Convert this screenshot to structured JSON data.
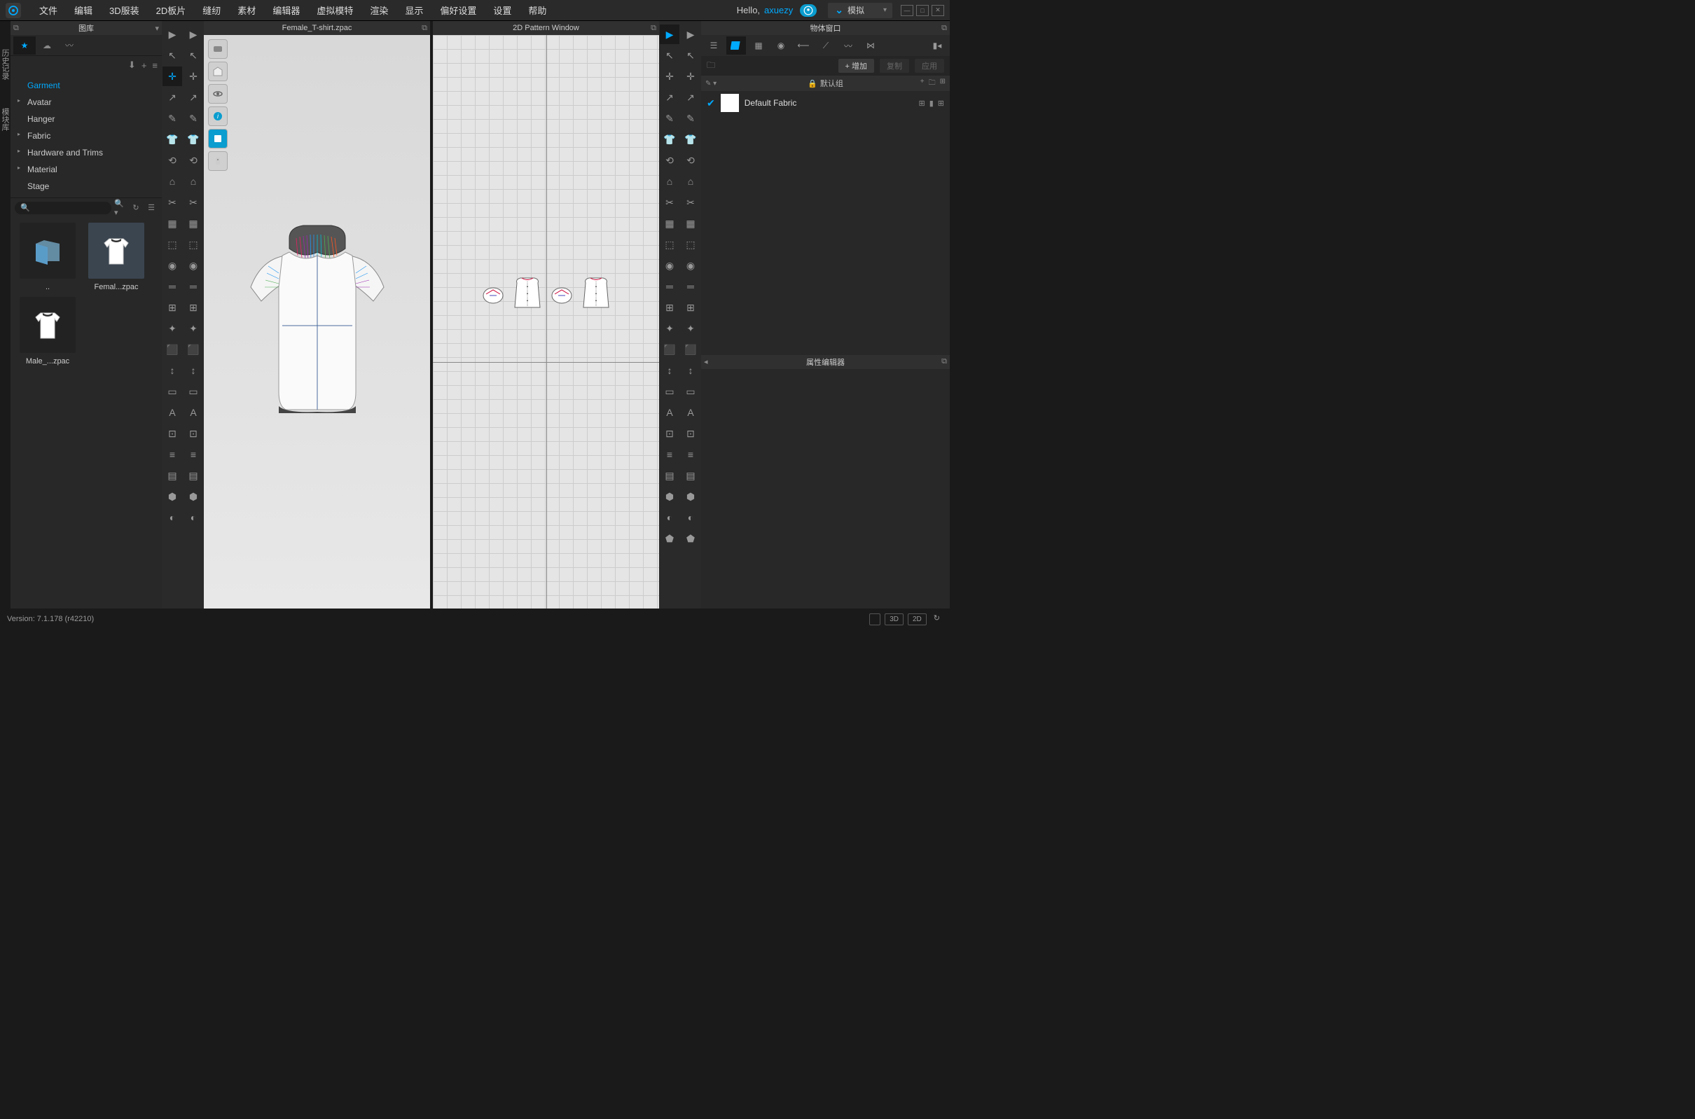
{
  "menubar": {
    "items": [
      "文件",
      "编辑",
      "3D服装",
      "2D板片",
      "缝纫",
      "素材",
      "编辑器",
      "虚拟模特",
      "渲染",
      "显示",
      "偏好设置",
      "设置",
      "帮助"
    ],
    "hello": "Hello,",
    "user": "axuezy",
    "simulate": "模拟"
  },
  "side_tabs": [
    "历史记录",
    "模块库"
  ],
  "library": {
    "title": "图库",
    "tree": [
      {
        "label": "Garment",
        "sel": true,
        "exp": ""
      },
      {
        "label": "Avatar",
        "exp": "▸"
      },
      {
        "label": "Hanger",
        "exp": ""
      },
      {
        "label": "Fabric",
        "exp": "▸"
      },
      {
        "label": "Hardware and Trims",
        "exp": "▸"
      },
      {
        "label": "Material",
        "exp": "▸"
      },
      {
        "label": "Stage",
        "exp": ""
      }
    ],
    "thumbs": [
      {
        "label": "..",
        "kind": "folder"
      },
      {
        "label": "Femal...zpac",
        "kind": "shirt",
        "sel": true
      },
      {
        "label": "Male_...zpac",
        "kind": "shirt"
      }
    ]
  },
  "view3d": {
    "title": "Female_T-shirt.zpac"
  },
  "view2d": {
    "title": "2D Pattern Window"
  },
  "objects": {
    "title": "物体窗口",
    "add": "+ 增加",
    "copy": "复制",
    "apply": "应用",
    "group": "默认组",
    "items": [
      {
        "name": "Default Fabric"
      }
    ]
  },
  "props": {
    "title": "属性编辑器"
  },
  "status": {
    "version": "Version: 7.1.178 (r42210)",
    "btns": [
      "3D",
      "2D"
    ]
  }
}
